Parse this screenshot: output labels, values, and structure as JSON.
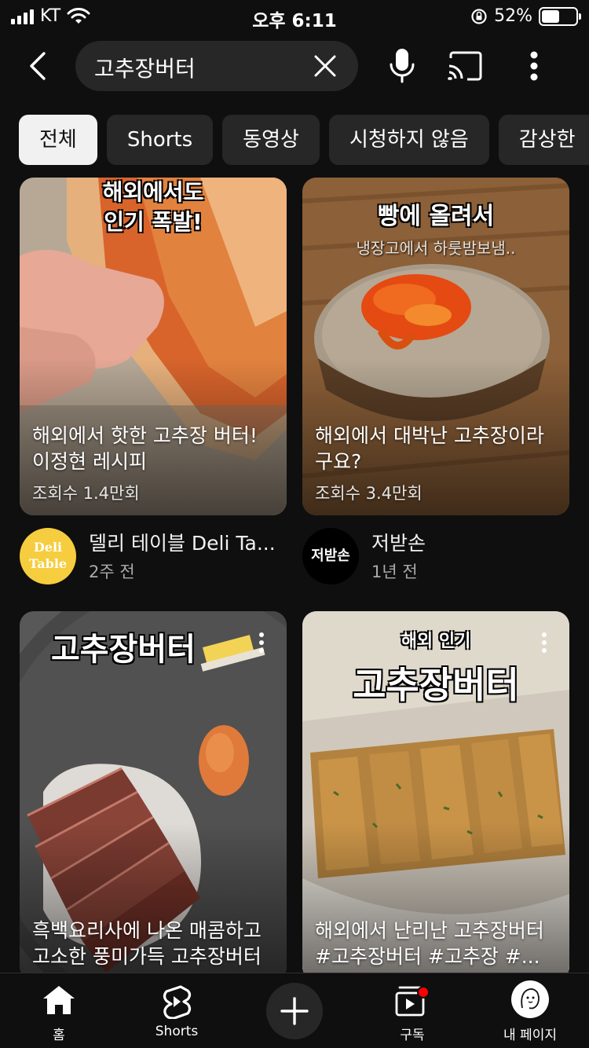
{
  "status_bar": {
    "carrier": "KT",
    "time": "오후 6:11",
    "battery": "52%",
    "battery_level": 0.52
  },
  "search": {
    "query": "고추장버터"
  },
  "icons": {
    "back": "back-arrow-icon",
    "clear": "close-icon",
    "mic": "microphone-icon",
    "cast": "cast-icon",
    "more": "more-vert-icon"
  },
  "chips": [
    "전체",
    "Shorts",
    "동영상",
    "시청하지 않음",
    "감상한"
  ],
  "cards": [
    {
      "overlay_lines": [
        "해외에서도",
        "인기 폭발!"
      ],
      "title": "해외에서 핫한 고추장 버터! 이정현 레시피",
      "views": "조회수 1.4만회"
    },
    {
      "overlay_lines": [
        "빵에 올려서",
        "냉장고에서 하룻밤보냄.."
      ],
      "title": "해외에서 대박난 고추장이라구요?",
      "views": "조회수 3.4만회"
    },
    {
      "overlay_lines": [
        "고추장버터"
      ],
      "title": "흑백요리사에 나온 매콤하고 고소한 풍미가득 고추장버터"
    },
    {
      "overlay_lines": [
        "해외 인기",
        "고추장버터"
      ],
      "title": "해외에서 난리난 고추장버터 #고추장버터  #고추장 #..."
    }
  ],
  "channels": [
    {
      "avatar_text": [
        "Deli",
        "Table"
      ],
      "name": "델리 테이블 Deli Ta...",
      "time": "2주 전"
    },
    {
      "avatar_text": [
        "저받손"
      ],
      "name": "저받손",
      "time": "1년 전"
    }
  ],
  "bottom_nav": {
    "home": "홈",
    "shorts": "Shorts",
    "subscriptions": "구독",
    "my_page": "내 페이지"
  },
  "colors": {
    "background": "#0f0f0f",
    "chip_bg": "#272727",
    "chip_active_bg": "#f1f1f1",
    "notification_dot": "#ff0000",
    "deli_avatar": "#f6cd3e"
  }
}
